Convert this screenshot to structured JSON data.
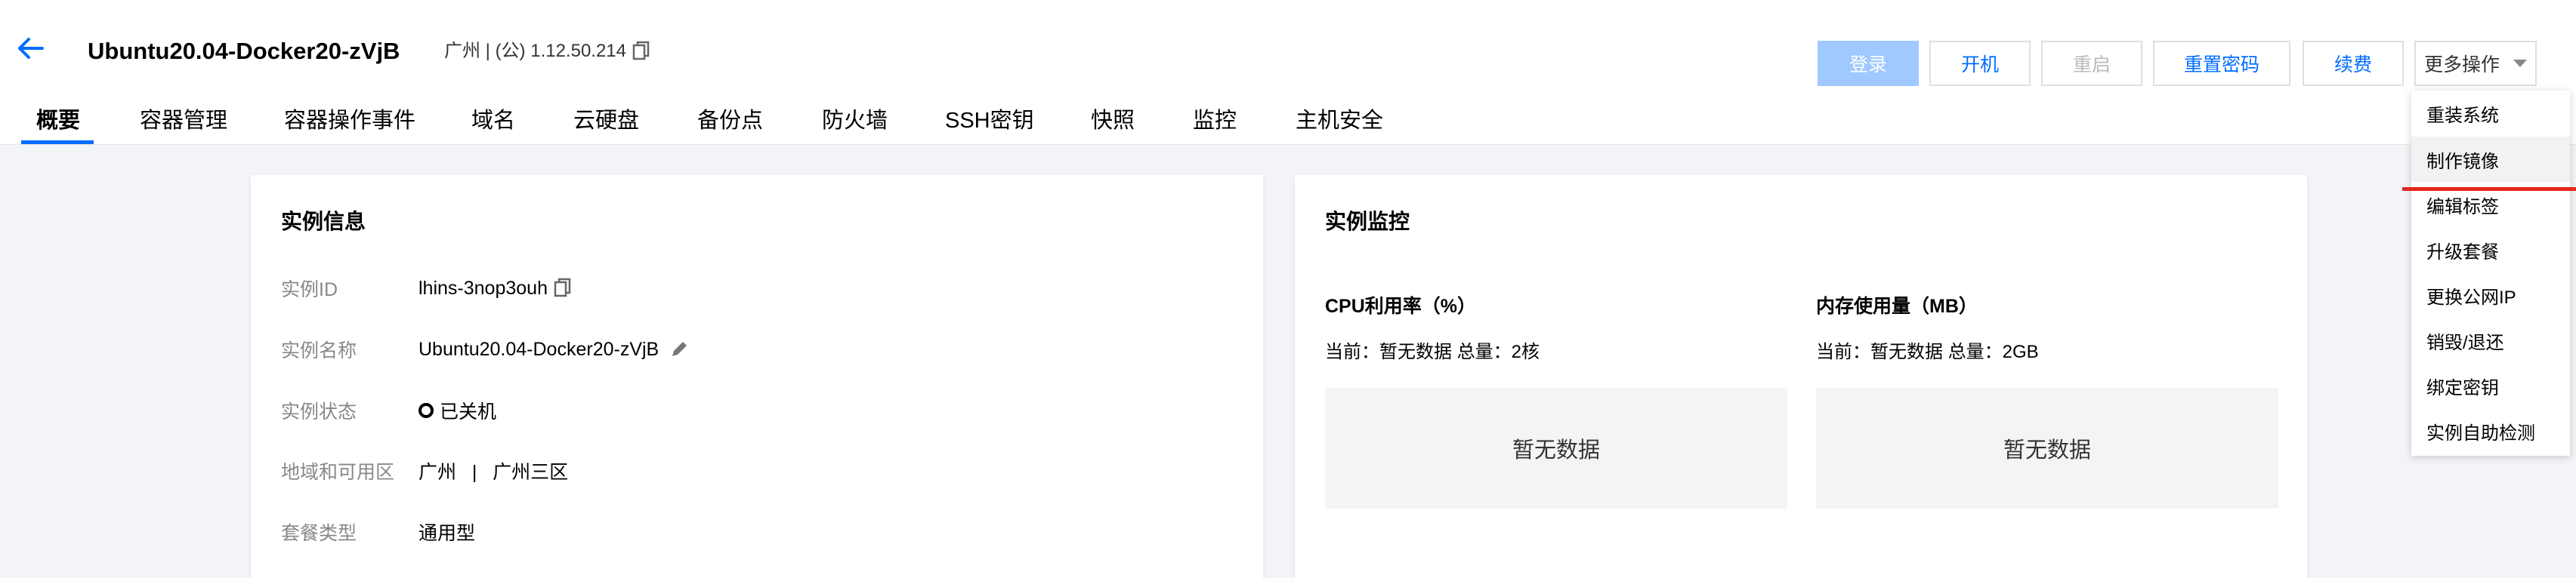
{
  "header": {
    "title": "Ubuntu20.04-Docker20-zVjB",
    "region_ip": "广州 | (公) 1.12.50.214"
  },
  "toolbar": {
    "login": "登录",
    "power_on": "开机",
    "restart": "重启",
    "reset_password": "重置密码",
    "renew": "续费",
    "more": "更多操作"
  },
  "tabs": [
    "概要",
    "容器管理",
    "容器操作事件",
    "域名",
    "云硬盘",
    "备份点",
    "防火墙",
    "SSH密钥",
    "快照",
    "监控",
    "主机安全"
  ],
  "instance_info": {
    "title": "实例信息",
    "rows": [
      {
        "label": "实例ID",
        "value": "lhins-3nop3ouh"
      },
      {
        "label": "实例名称",
        "value": "Ubuntu20.04-Docker20-zVjB"
      },
      {
        "label": "实例状态",
        "value": "已关机"
      },
      {
        "label": "地域和可用区",
        "value": "广州   |   广州三区"
      },
      {
        "label": "套餐类型",
        "value": "通用型"
      }
    ]
  },
  "monitor": {
    "title": "实例监控",
    "cpu": {
      "title": "CPU利用率（%）",
      "sub": "当前：暂无数据 总量：2核",
      "empty": "暂无数据"
    },
    "mem": {
      "title": "内存使用量（MB）",
      "sub": "当前：暂无数据 总量：2GB",
      "empty": "暂无数据"
    }
  },
  "more_menu": [
    "重装系统",
    "制作镜像",
    "编辑标签",
    "升级套餐",
    "更换公网IP",
    "销毁/退还",
    "绑定密钥",
    "实例自助检测"
  ],
  "colors": {
    "accent": "#006eff",
    "disabled_primary": "#9fc9ff",
    "annotation_red": "#e5271c"
  }
}
